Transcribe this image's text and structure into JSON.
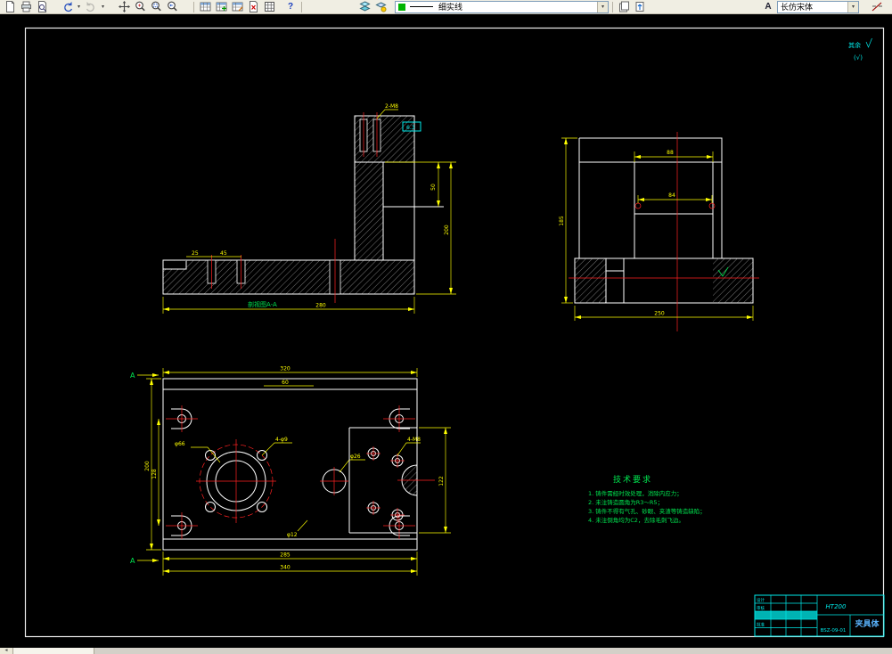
{
  "toolbar": {
    "linetype": {
      "value": "细实线"
    },
    "font": {
      "value": "长仿宋体"
    },
    "help_glyph": "?",
    "text_style_glyph": "A",
    "caret_glyph": "▾"
  },
  "statusbar": {
    "scroll_left_glyph": "◄"
  },
  "canvas": {
    "roughness_note": {
      "line1": "其余",
      "line2": "(√)"
    },
    "views": {
      "section": {
        "label": "剖视图A-A"
      }
    },
    "tech_req": {
      "title": "技术要求",
      "items": [
        "1. 铸件需经时效处理，消除内应力；",
        "2. 未注铸造圆角为R3～R5；",
        "3. 铸件不得有气孔、砂眼、夹渣等铸造缺陷；",
        "4. 未注倒角均为C2，去除毛刺飞边。"
      ]
    },
    "title_block": {
      "material": "HT200",
      "part_name": "夹具体",
      "drawing_no": "BSZ-09-01",
      "labels": {
        "design": "设计",
        "check": "审核",
        "approve": "批准"
      }
    },
    "dims": {
      "sv_top_thread": "2-M8",
      "sv_rough": "6.3",
      "sv_right1": "50",
      "sv_right2": "200",
      "sv_base1": "25",
      "sv_base2": "45",
      "sv_bottom": "280",
      "side_top": "88",
      "side_mid": "84",
      "side_bottom": "250",
      "side_left": "185",
      "pv_top": "320",
      "pv_top_small": "60",
      "pv_bottom1": "285",
      "pv_bottom2": "340",
      "pv_left1": "200",
      "pv_left2": "128",
      "pv_right": "122",
      "pv_holes": "4-φ9",
      "pv_bore": "φ66",
      "pv_mid": "φ26",
      "pv_tap": "4-M8",
      "pv_small": "φ12",
      "sec_a": "A"
    },
    "colors": {
      "outline": "#ffffff",
      "dim": "#ffff00",
      "center": "#ff2222",
      "annot": "#00e650",
      "tblock": "#00eaea"
    }
  }
}
